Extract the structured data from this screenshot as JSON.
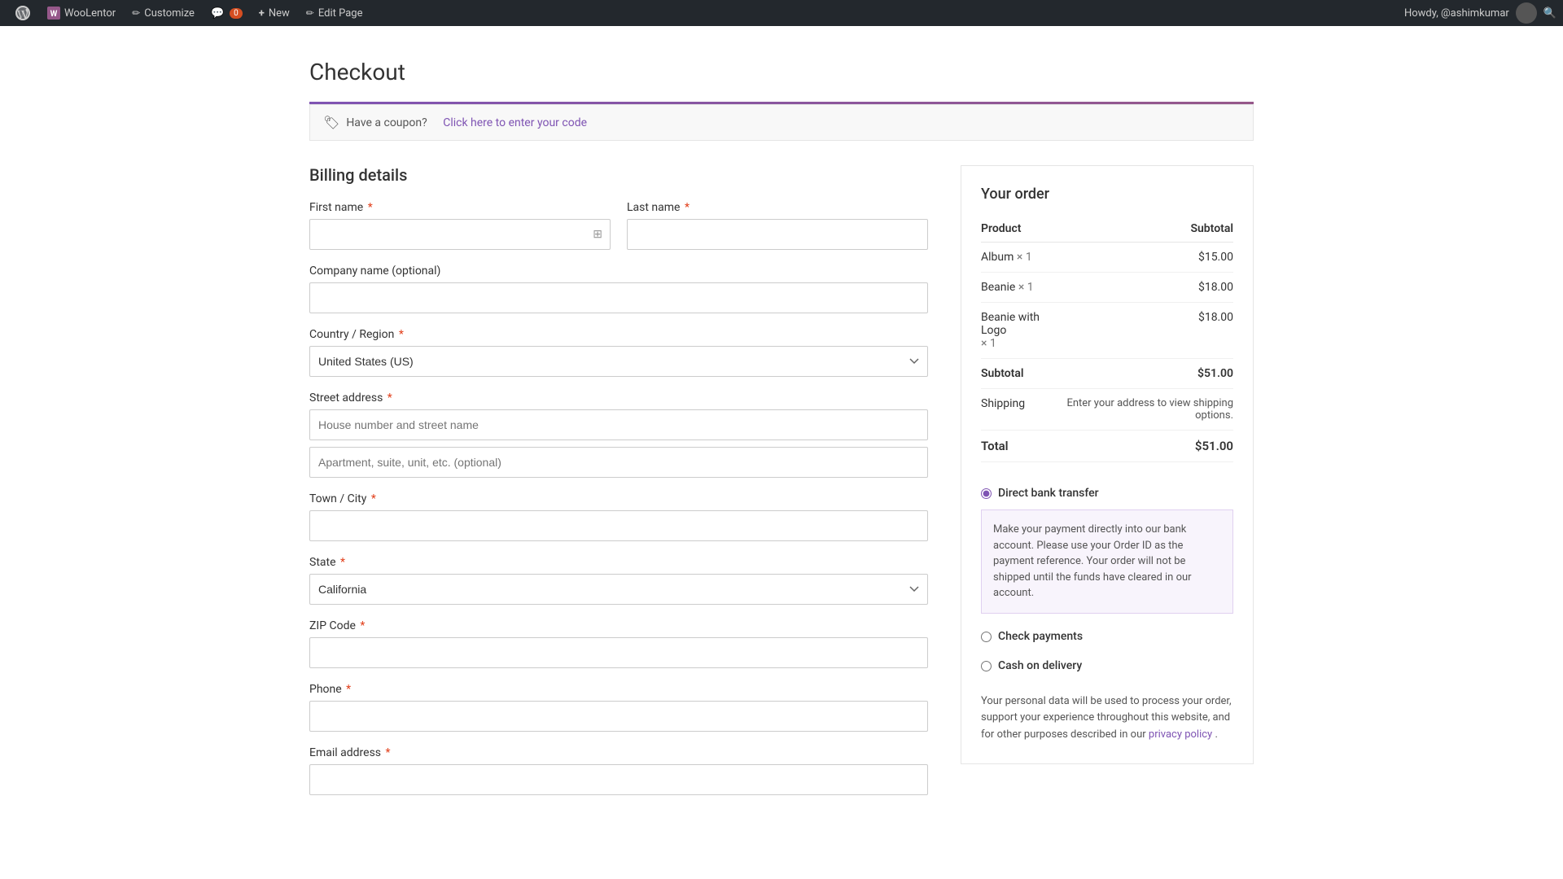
{
  "adminbar": {
    "items": [
      {
        "id": "wp-logo",
        "label": "WordPress",
        "icon": "wp-logo"
      },
      {
        "id": "woolentor",
        "label": "WooLentor",
        "icon": "woolentor"
      },
      {
        "id": "customize",
        "label": "Customize",
        "icon": "pencil"
      },
      {
        "id": "comments",
        "label": "0",
        "icon": "comments",
        "badge": "0"
      },
      {
        "id": "new",
        "label": "New",
        "icon": "plus"
      },
      {
        "id": "edit-page",
        "label": "Edit Page",
        "icon": "pencil"
      }
    ],
    "user": "Howdy, @ashimkumar",
    "search_icon": "search"
  },
  "page": {
    "title": "Checkout"
  },
  "coupon": {
    "text": "Have a coupon?",
    "link_text": "Click here to enter your code"
  },
  "billing": {
    "section_title": "Billing details",
    "fields": {
      "first_name_label": "First name",
      "last_name_label": "Last name",
      "company_label": "Company name (optional)",
      "country_label": "Country / Region",
      "country_value": "United States (US)",
      "street_label": "Street address",
      "street_placeholder": "House number and street name",
      "apt_placeholder": "Apartment, suite, unit, etc. (optional)",
      "city_label": "Town / City",
      "state_label": "State",
      "state_value": "California",
      "zip_label": "ZIP Code",
      "phone_label": "Phone",
      "email_label": "Email address"
    }
  },
  "order": {
    "title": "Your order",
    "col_product": "Product",
    "col_subtotal": "Subtotal",
    "items": [
      {
        "name": "Album",
        "qty": "× 1",
        "price": "$15.00"
      },
      {
        "name": "Beanie",
        "qty": "× 1",
        "price": "$18.00"
      },
      {
        "name": "Beanie with Logo",
        "qty": "× 1",
        "price": "$18.00"
      }
    ],
    "subtotal_label": "Subtotal",
    "subtotal_value": "$51.00",
    "shipping_label": "Shipping",
    "shipping_value": "Enter your address to view shipping options.",
    "total_label": "Total",
    "total_value": "$51.00"
  },
  "payment": {
    "methods": [
      {
        "id": "direct-bank",
        "label": "Direct bank transfer",
        "checked": true,
        "description": "Make your payment directly into our bank account. Please use your Order ID as the payment reference. Your order will not be shipped until the funds have cleared in our account."
      },
      {
        "id": "check",
        "label": "Check payments",
        "checked": false,
        "description": ""
      },
      {
        "id": "cod",
        "label": "Cash on delivery",
        "checked": false,
        "description": ""
      }
    ],
    "privacy_text": "Your personal data will be used to process your order, support your experience throughout this website, and for other purposes described in our",
    "privacy_link": "privacy policy",
    "privacy_end": "."
  }
}
